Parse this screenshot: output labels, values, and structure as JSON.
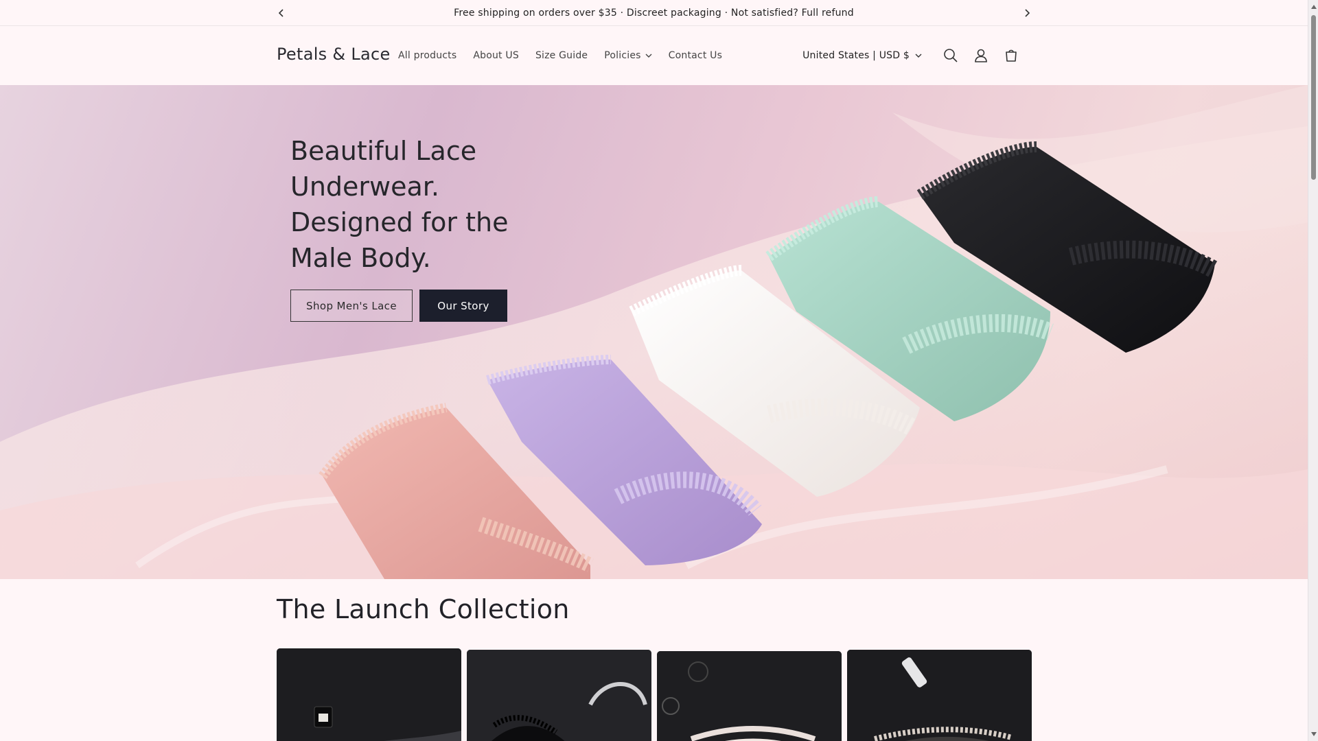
{
  "announcement": {
    "text": "Free shipping on orders over $35 · Discreet packaging · Not satisfied? Full refund"
  },
  "header": {
    "logo": "Petals & Lace",
    "nav": [
      {
        "label": "All products"
      },
      {
        "label": "About US"
      },
      {
        "label": "Size Guide"
      },
      {
        "label": "Policies"
      },
      {
        "label": "Contact Us"
      }
    ],
    "locale": "United States | USD $",
    "icons": [
      "search-icon",
      "account-icon",
      "cart-icon"
    ]
  },
  "hero": {
    "title": "Beautiful Lace Underwear. Designed for the Male Body.",
    "buttons": {
      "shop": "Shop Men's Lace",
      "story": "Our Story"
    }
  },
  "collection": {
    "title": "The Launch Collection"
  },
  "colors": {
    "background": "#fff6f8",
    "accent": "#1c1f2c",
    "garments": [
      "#e8a9a6",
      "#b9a3d9",
      "#f6f1ee",
      "#a8d4c4",
      "#1b1b1e"
    ]
  }
}
